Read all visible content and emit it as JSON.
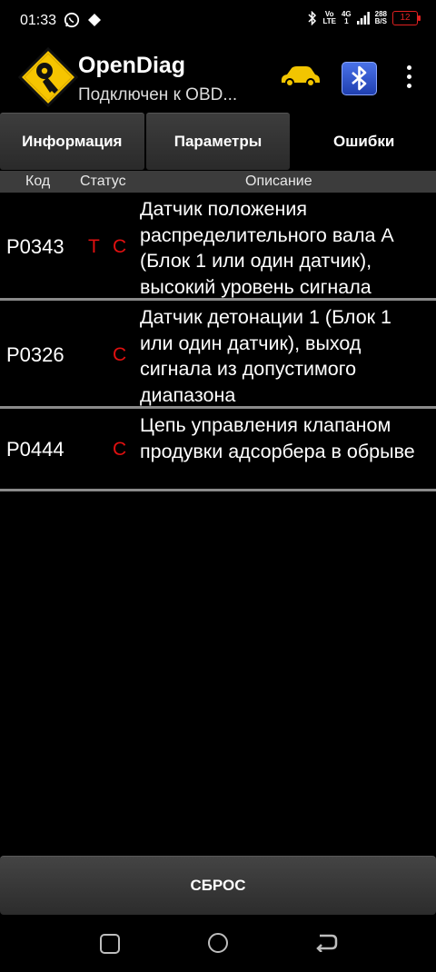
{
  "status_bar": {
    "time": "01:33",
    "net_top": "Vo",
    "net_bottom": "LTE",
    "gen_top": "4G",
    "gen_bottom": "1",
    "speed_top": "288",
    "speed_bottom": "B/S",
    "battery": "12"
  },
  "app": {
    "title": "OpenDiag",
    "subtitle": "Подключен к OBD..."
  },
  "tabs": [
    {
      "label": "Информация"
    },
    {
      "label": "Параметры"
    },
    {
      "label": "Ошибки"
    }
  ],
  "columns": {
    "code": "Код",
    "status": "Статус",
    "description": "Описание"
  },
  "errors": [
    {
      "code": "P0343",
      "status_t": "T",
      "status_c": "C",
      "description": "Датчик положения распределительного вала A (Блок 1 или один датчик), высокий уровень сигнала"
    },
    {
      "code": "P0326",
      "status_t": "",
      "status_c": "C",
      "description": "Датчик детонации 1 (Блок 1 или один датчик), выход сигнала из допустимого диапазона"
    },
    {
      "code": "P0444",
      "status_t": "",
      "status_c": "C",
      "description": "Цепь управления клапаном продувки адсорбера в обрыве"
    }
  ],
  "reset_label": "СБРОС",
  "colors": {
    "status_red": "#e01010",
    "car_yellow": "#f2c500",
    "bluetooth_blue": "#2f55d4"
  }
}
